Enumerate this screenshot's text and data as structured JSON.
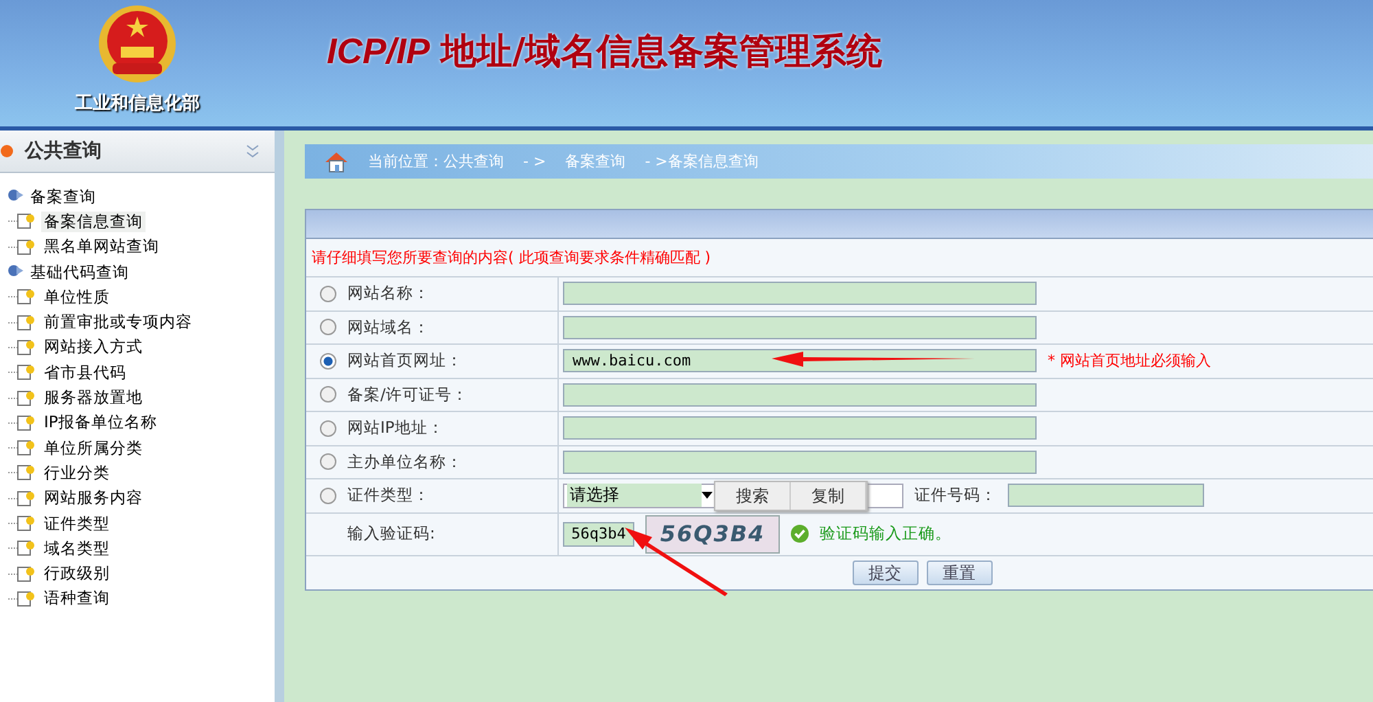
{
  "header": {
    "ministry": "工业和信息化部",
    "title_latin": "ICP/IP",
    "title": "地址/域名信息备案管理系统"
  },
  "sidebar": {
    "title": "公共查询",
    "groups": [
      {
        "label": "备案查询",
        "expanded": true,
        "children": [
          {
            "label": "备案信息查询",
            "selected": true
          },
          {
            "label": "黑名单网站查询",
            "selected": false
          }
        ]
      },
      {
        "label": "基础代码查询",
        "expanded": true,
        "children": [
          {
            "label": "单位性质",
            "selected": false
          },
          {
            "label": "前置审批或专项内容",
            "selected": false
          },
          {
            "label": "网站接入方式",
            "selected": false
          },
          {
            "label": "省市县代码",
            "selected": false
          },
          {
            "label": "服务器放置地",
            "selected": false
          },
          {
            "label": "IP报备单位名称",
            "selected": false
          },
          {
            "label": "单位所属分类",
            "selected": false
          },
          {
            "label": "行业分类",
            "selected": false
          },
          {
            "label": "网站服务内容",
            "selected": false
          },
          {
            "label": "证件类型",
            "selected": false
          },
          {
            "label": "域名类型",
            "selected": false
          },
          {
            "label": "行政级别",
            "selected": false
          },
          {
            "label": "语种查询",
            "selected": false
          }
        ]
      }
    ]
  },
  "breadcrumb": {
    "label": "当前位置：公共查询",
    "parts": [
      "- >",
      "备案查询",
      "- >备案信息查询"
    ]
  },
  "form": {
    "note": "请仔细填写您所要查询的内容( 此项查询要求条件精确匹配 )",
    "rows": [
      {
        "kind": "text",
        "label": "网站名称：",
        "selected": false
      },
      {
        "kind": "text",
        "label": "网站域名：",
        "selected": false
      },
      {
        "kind": "text",
        "label": "网站首页网址：",
        "selected": true,
        "value": "www.baicu.com",
        "hint": "* 网站首页地址必须输入"
      },
      {
        "kind": "text",
        "label": "备案/许可证号：",
        "selected": false
      },
      {
        "kind": "text",
        "label": "网站IP地址：",
        "selected": false
      },
      {
        "kind": "text",
        "label": "主办单位名称：",
        "selected": false
      },
      {
        "kind": "select",
        "label": "证件类型：",
        "selected": false,
        "select_value": "请选择",
        "number_label": "证件号码："
      }
    ],
    "captcha": {
      "label": "输入验证码:",
      "value": "56q3b4",
      "image_text": "56Q3B4",
      "status": "验证码输入正确。"
    },
    "buttons": [
      "提交",
      "重置"
    ]
  },
  "context_menu": [
    "搜索",
    "复制"
  ]
}
